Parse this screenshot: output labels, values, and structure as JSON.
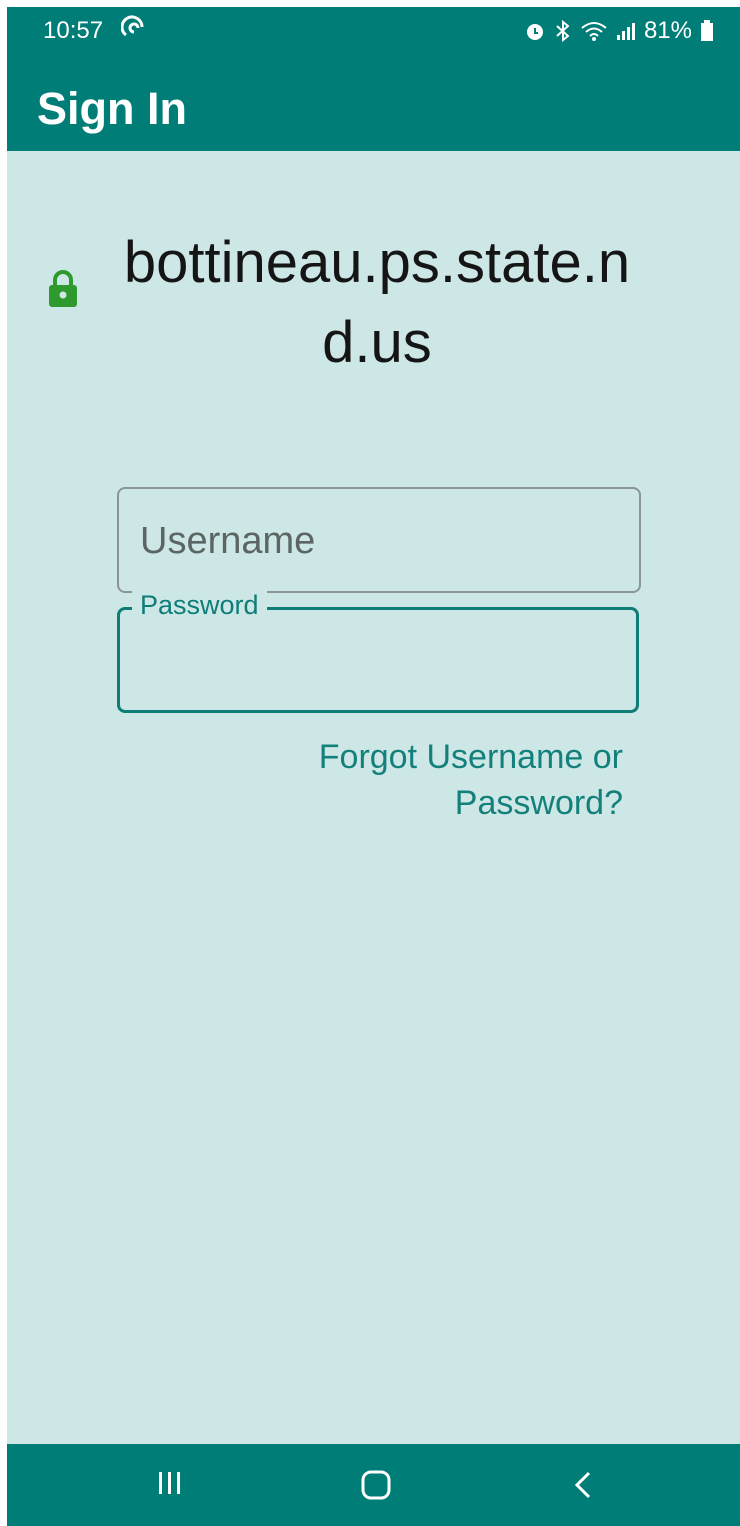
{
  "status_bar": {
    "time": "10:57",
    "battery": "81%",
    "icons": [
      "sync-icon",
      "alarm-icon",
      "bluetooth-icon",
      "wifi-icon",
      "signal-icon",
      "battery-icon"
    ]
  },
  "app_bar": {
    "title": "Sign In"
  },
  "site": {
    "domain": "bottineau.ps.state.nd.us",
    "secure_icon": "lock-icon"
  },
  "form": {
    "username": {
      "placeholder": "Username",
      "value": ""
    },
    "password": {
      "label": "Password",
      "value": ""
    },
    "forgot_link": "Forgot Username or Password?"
  },
  "nav_bar": {
    "buttons": [
      "recents-icon",
      "home-icon",
      "back-icon"
    ]
  },
  "colors": {
    "primary": "#007d77",
    "background": "#cde7e6",
    "accent": "#0e7d78",
    "lock": "#2e9a2e"
  }
}
